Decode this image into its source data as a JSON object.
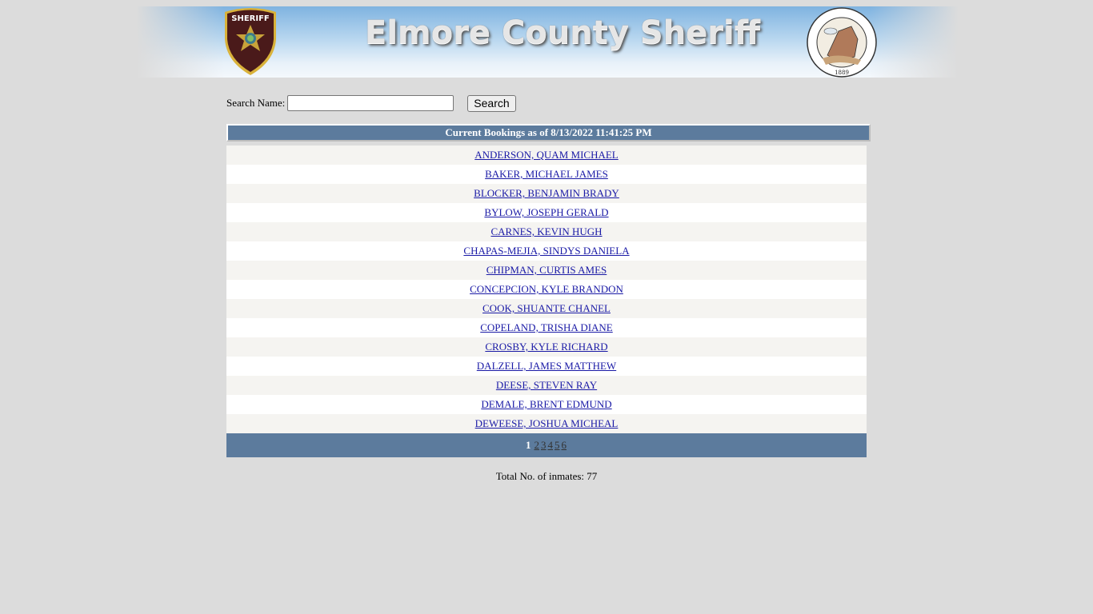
{
  "banner": {
    "title": "Elmore County Sheriff",
    "left_logo": "sheriff-badge",
    "left_logo_text": "SHERIFF",
    "right_logo": "county-seal",
    "right_logo_year": "1889"
  },
  "search": {
    "label": "Search Name:",
    "value": "",
    "placeholder": "",
    "button_label": "Search"
  },
  "bookings": {
    "header": "Current Bookings as of 8/13/2022 11:41:25 PM",
    "rows": [
      "ANDERSON, QUAM MICHAEL",
      "BAKER, MICHAEL JAMES",
      "BLOCKER, BENJAMIN BRADY",
      "BYLOW, JOSEPH GERALD",
      "CARNES, KEVIN HUGH",
      "CHAPAS-MEJIA, SINDYS DANIELA",
      "CHIPMAN, CURTIS AMES",
      "CONCEPCION, KYLE BRANDON",
      "COOK, SHUANTE CHANEL",
      "COPELAND, TRISHA DIANE",
      "CROSBY, KYLE RICHARD",
      "DALZELL, JAMES MATTHEW",
      "DEESE, STEVEN RAY",
      "DEMALE, BRENT EDMUND",
      "DEWEESE, JOSHUA MICHEAL"
    ]
  },
  "pager": {
    "current": "1",
    "pages": [
      "2",
      "3",
      "4",
      "5",
      "6"
    ]
  },
  "footer": {
    "total_text": "Total No. of inmates: 77"
  },
  "colors": {
    "header_bg": "#5c7b9d",
    "link": "#1a1aa6",
    "page_bg": "#dcdcdc"
  }
}
